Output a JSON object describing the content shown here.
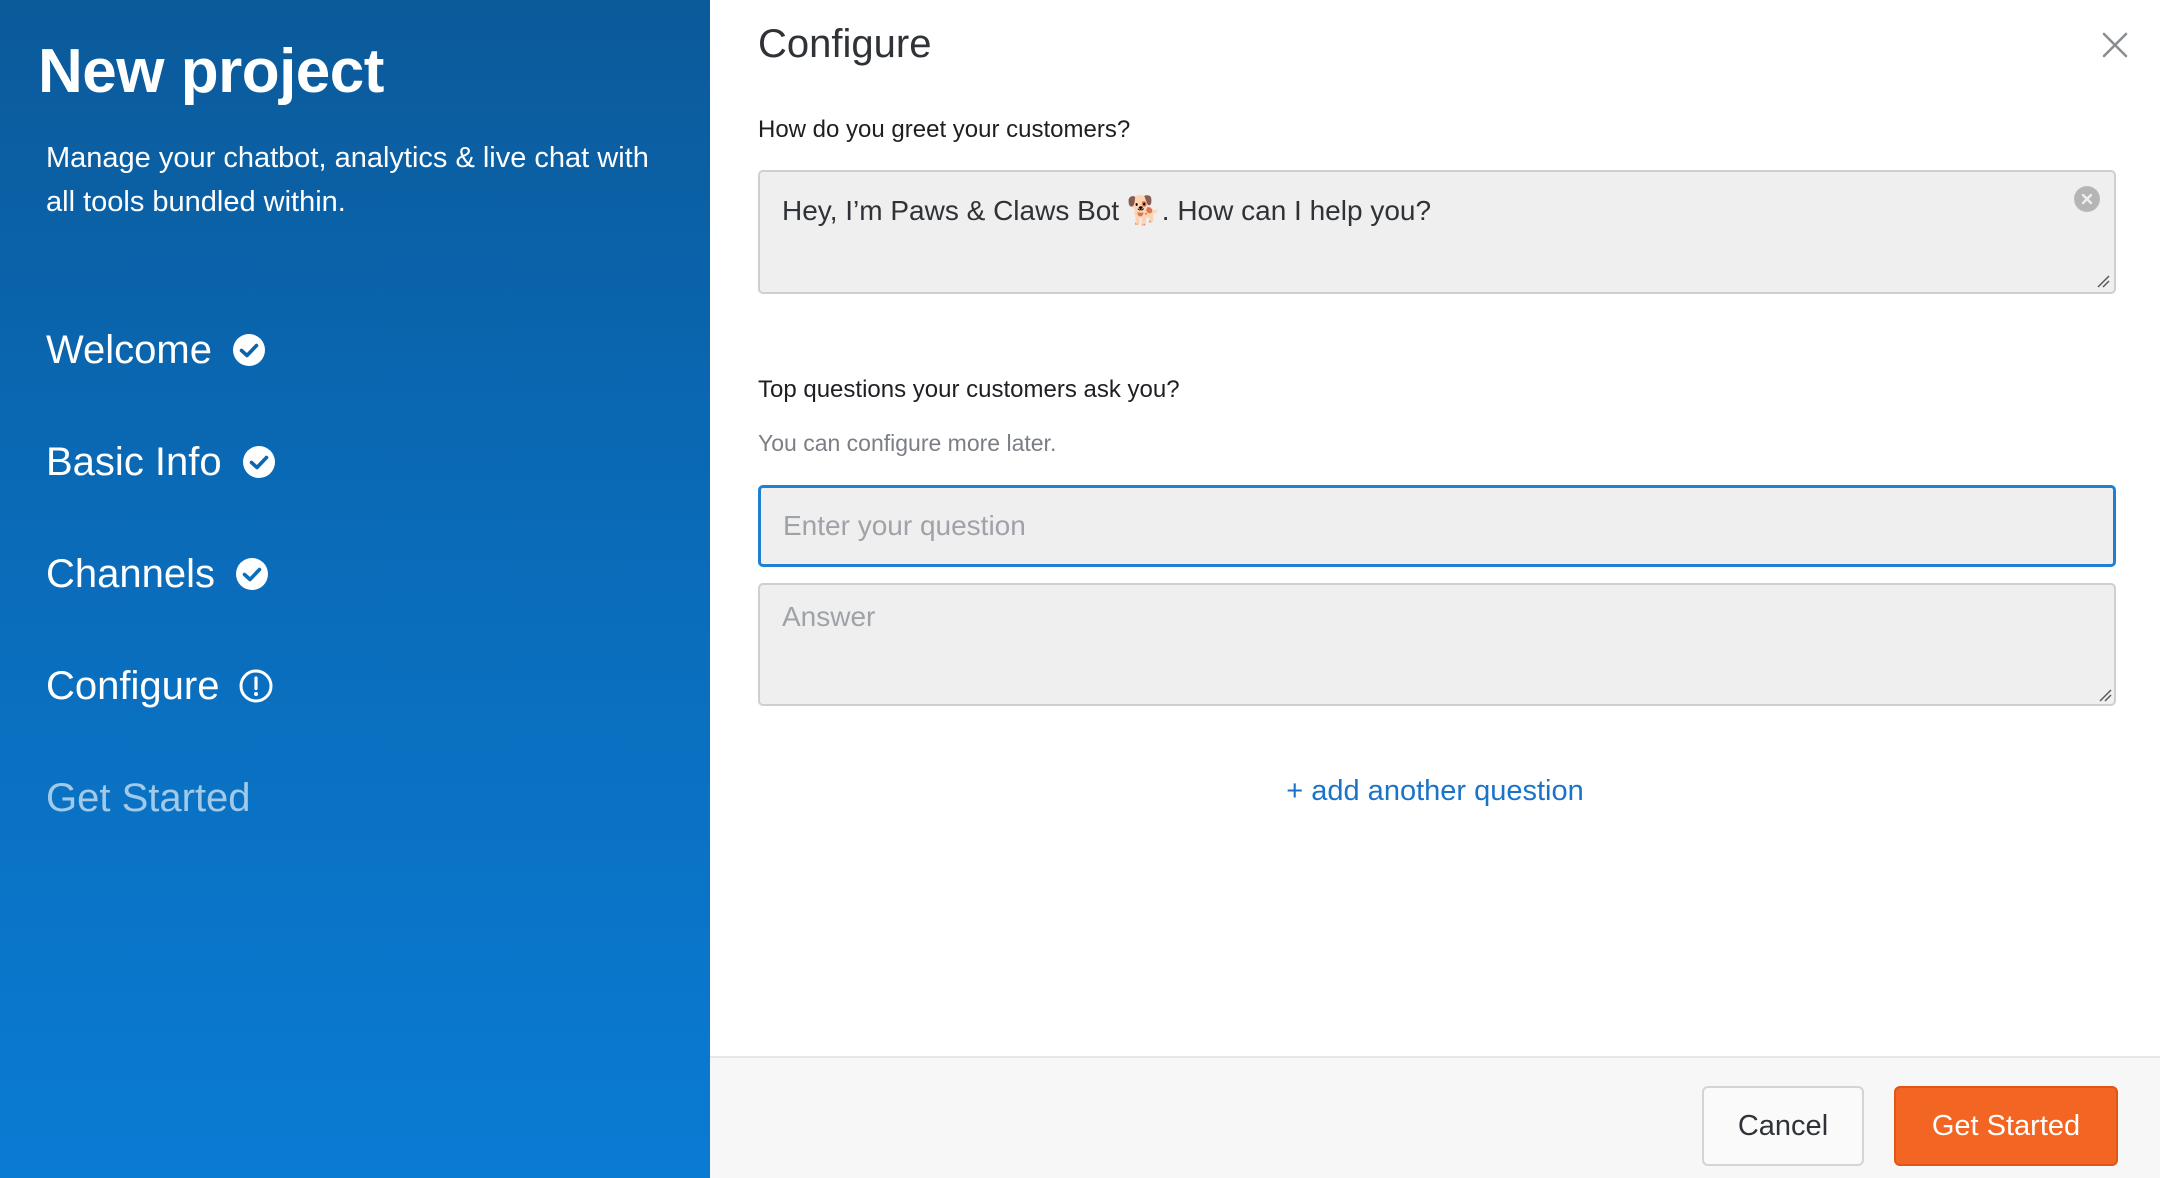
{
  "sidebar": {
    "title": "New project",
    "subtitle": "Manage your chatbot, analytics & live chat with all tools bundled within.",
    "steps": [
      {
        "label": "Welcome",
        "status": "completed",
        "icon": "check-circle-icon"
      },
      {
        "label": "Basic Info",
        "status": "completed",
        "icon": "check-circle-icon"
      },
      {
        "label": "Channels",
        "status": "completed",
        "icon": "check-circle-icon"
      },
      {
        "label": "Configure",
        "status": "current",
        "icon": "exclamation-circle-icon"
      },
      {
        "label": "Get Started",
        "status": "pending",
        "icon": ""
      }
    ],
    "colors": {
      "gradient_top": "#0b5a9a",
      "gradient_bottom": "#0a7bd3"
    }
  },
  "main": {
    "title": "Configure",
    "close_icon": "close-icon",
    "greeting": {
      "label": "How do you greet your customers?",
      "value": "Hey, I’m Paws & Claws Bot 🐕. How can I help you?",
      "clear_icon": "clear-circle-icon"
    },
    "questions": {
      "label": "Top questions your customers ask you?",
      "hint": "You can configure more later.",
      "question_placeholder": "Enter your question",
      "question_value": "",
      "answer_placeholder": "Answer",
      "answer_value": "",
      "add_link": "+ add another question"
    }
  },
  "footer": {
    "cancel_label": "Cancel",
    "start_label": "Get Started",
    "colors": {
      "primary": "#f26522",
      "link": "#1a73c7",
      "focus": "#1f7fd1"
    }
  }
}
